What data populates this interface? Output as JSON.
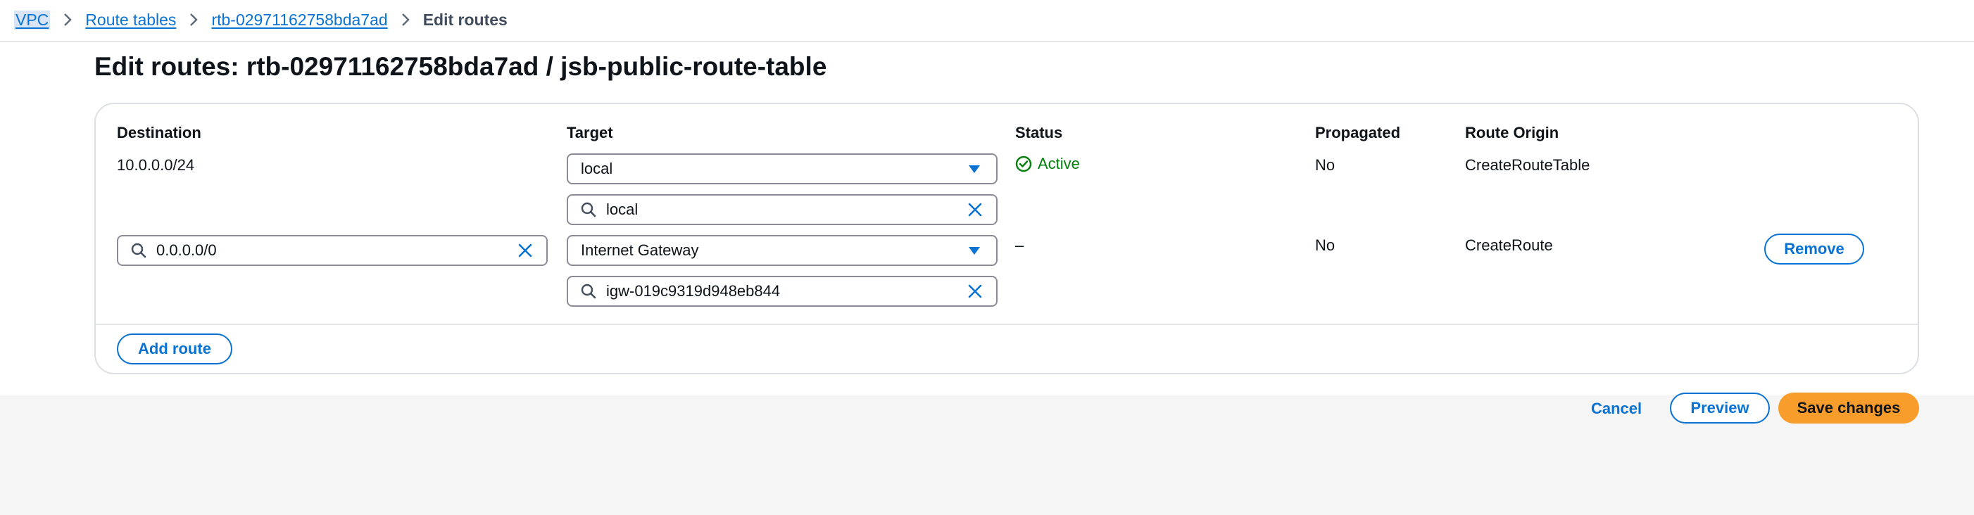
{
  "breadcrumb": {
    "items": [
      "VPC",
      "Route tables",
      "rtb-02971162758bda7ad"
    ],
    "current": "Edit routes"
  },
  "page": {
    "title": "Edit routes: rtb-02971162758bda7ad / jsb-public-route-table"
  },
  "table": {
    "headers": {
      "destination": "Destination",
      "target": "Target",
      "status": "Status",
      "propagated": "Propagated",
      "route_origin": "Route Origin"
    },
    "rows": [
      {
        "destination": "10.0.0.0/24",
        "target_type": "local",
        "target_value": "local",
        "status": "Active",
        "propagated": "No",
        "route_origin": "CreateRouteTable"
      },
      {
        "destination": "0.0.0.0/0",
        "target_type": "Internet Gateway",
        "target_value": "igw-019c9319d948eb844",
        "status": "–",
        "propagated": "No",
        "route_origin": "CreateRoute",
        "remove_label": "Remove"
      }
    ],
    "add_route_label": "Add route"
  },
  "actions": {
    "cancel": "Cancel",
    "preview": "Preview",
    "save": "Save changes"
  },
  "icons": {
    "breadcrumb_sep": "chevron-right-icon",
    "dropdown": "caret-down-icon",
    "search": "search-icon",
    "clear": "clear-x-icon",
    "status": "check-circle-icon"
  },
  "colors": {
    "link": "#0972d3",
    "success": "#037f0c",
    "primary_button": "#f89c2c",
    "border": "#8c8c94"
  }
}
